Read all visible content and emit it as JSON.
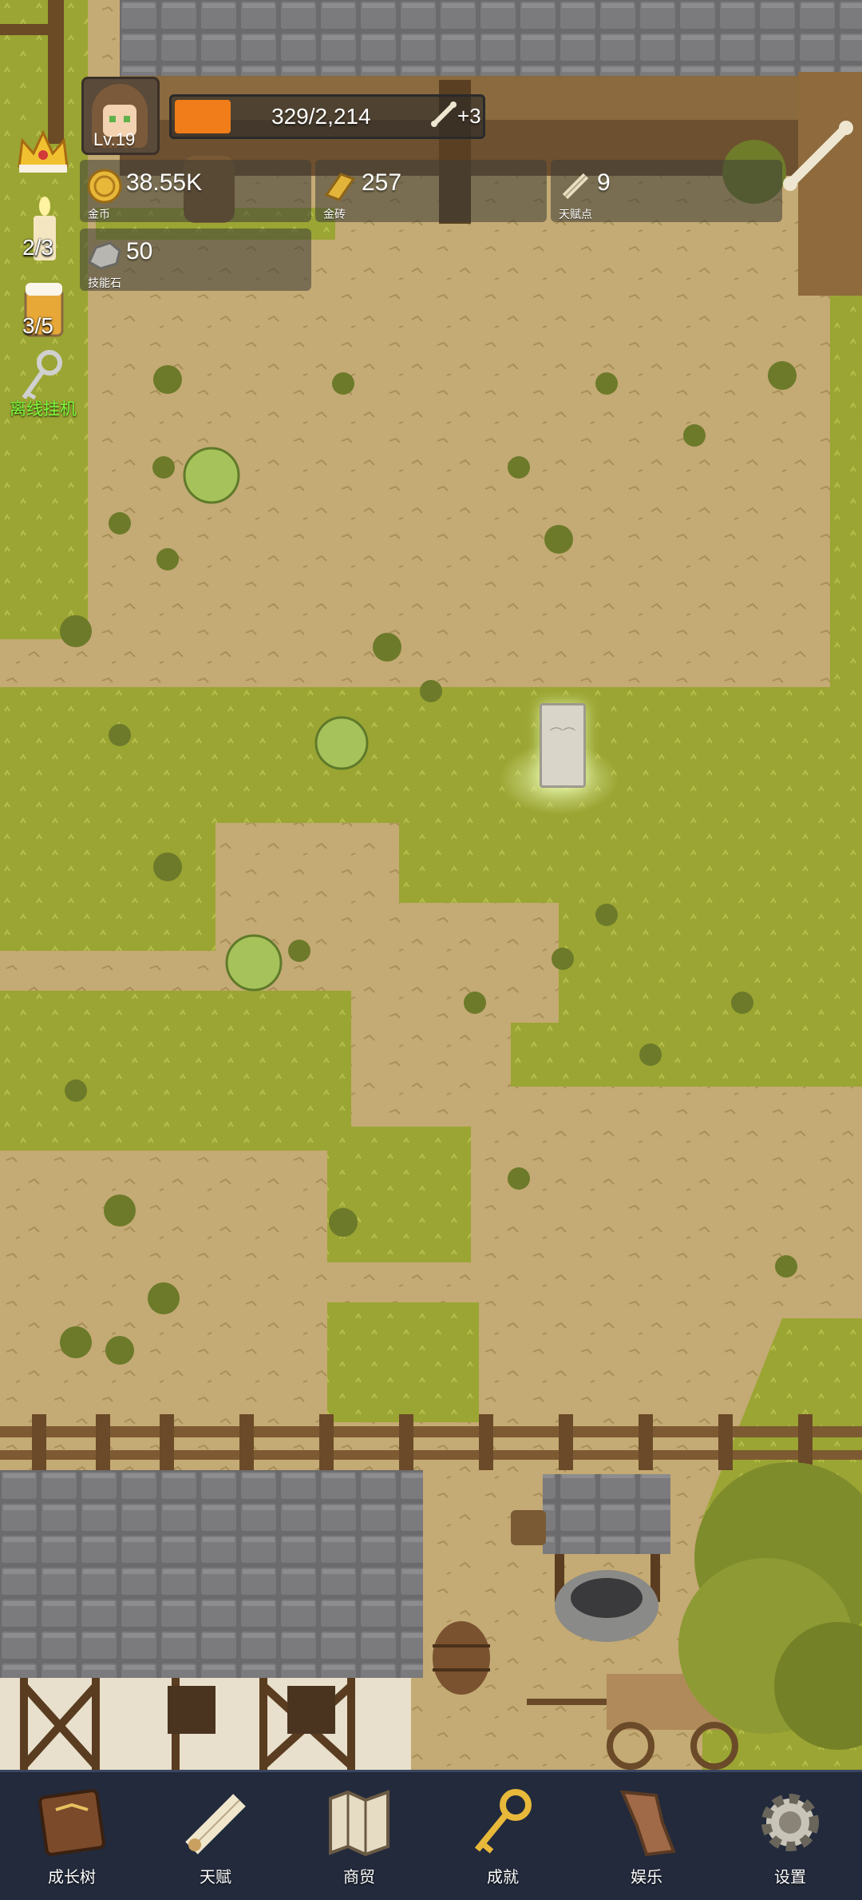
{
  "player": {
    "level": "Lv.19"
  },
  "exp": {
    "text": "329/2,214",
    "bonus": "+3",
    "fill": 0.149
  },
  "resources": {
    "gold": {
      "value": "38.55K",
      "label": "金币"
    },
    "gold_brick": {
      "value": "257",
      "label": "金砖"
    },
    "talent_points": {
      "value": "9",
      "label": "天赋点"
    },
    "skill_stone": {
      "value": "50",
      "label": "技能石"
    }
  },
  "side": {
    "candle": {
      "count": "2/3"
    },
    "beer": {
      "count": "3/5"
    },
    "idle": {
      "label": "离线挂机"
    }
  },
  "nav": [
    {
      "label": "成长树",
      "icon": "book-icon"
    },
    {
      "label": "天赋",
      "icon": "scroll-icon"
    },
    {
      "label": "商贸",
      "icon": "map-icon"
    },
    {
      "label": "成就",
      "icon": "key-icon"
    },
    {
      "label": "娱乐",
      "icon": "leather-icon"
    },
    {
      "label": "设置",
      "icon": "gear-icon"
    }
  ],
  "colors": {
    "grass": "#9aa436",
    "dirt": "#c2a873",
    "nav_bg": "#222a3c",
    "exp_bar": "#f07d1a",
    "idle_text": "#7dfc3a"
  }
}
